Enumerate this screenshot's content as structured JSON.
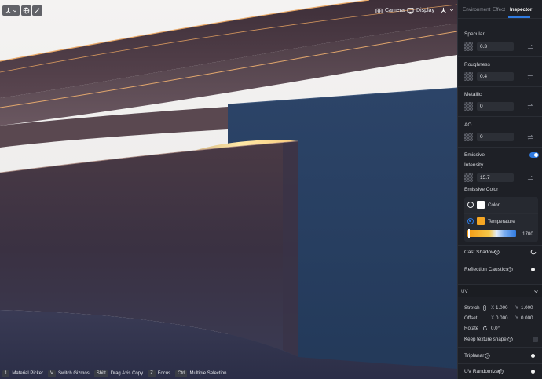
{
  "viewport": {
    "toolbar_left": {
      "transform_icon": "transform-gizmo-icon",
      "globe_icon": "globe-icon",
      "wand_icon": "magic-wand-icon"
    },
    "toolbar_right": {
      "camera_label": "Camera",
      "display_label": "Display",
      "lighting_icon": "lighting-icon"
    },
    "shortcuts": [
      {
        "key": "1",
        "label": "Material Picker"
      },
      {
        "key": "V",
        "label": "Switch Gizmos"
      },
      {
        "key": "Shift",
        "label": "Drag Axis Copy"
      },
      {
        "key": "Z",
        "label": "Focus"
      },
      {
        "key": "Ctrl",
        "label": "Multiple Selection"
      }
    ]
  },
  "inspector": {
    "tabs": [
      {
        "label": "Environment",
        "active": false
      },
      {
        "label": "Effect",
        "active": false
      },
      {
        "label": "Inspector",
        "active": true
      }
    ],
    "specular": {
      "label": "Specular",
      "value": "0.3"
    },
    "roughness": {
      "label": "Roughness",
      "value": "0.4"
    },
    "metallic": {
      "label": "Metallic",
      "value": "0"
    },
    "ao": {
      "label": "AO",
      "value": "0"
    },
    "emissive": {
      "label": "Emissive",
      "enabled": true,
      "intensity_label": "Intensity",
      "intensity_value": "15.7",
      "color_label": "Emissive Color",
      "color_option": "Color",
      "color_swatch": "#ffffff",
      "temperature_option": "Temperature",
      "temperature_swatch": "#f5a623",
      "temperature_value": "1700"
    },
    "cast_shadow": {
      "label": "Cast Shadow"
    },
    "reflection_caustics": {
      "label": "Reflection Caustics"
    },
    "uv": {
      "label": "UV",
      "stretch_label": "Stretch",
      "stretch_x_label": "X",
      "stretch_x": "1.000",
      "stretch_y_label": "Y",
      "stretch_y": "1.000",
      "offset_label": "Offset",
      "offset_x_label": "X",
      "offset_x": "0.000",
      "offset_y_label": "Y",
      "offset_y": "0.000",
      "rotate_label": "Rotate",
      "rotate_value": "0.0°",
      "keep_shape_label": "Keep texture shape"
    },
    "triplanar": {
      "label": "Triplanar"
    },
    "uv_randomizer": {
      "label": "UV Randomizer"
    }
  },
  "colors": {
    "accent": "#2f7ae0",
    "panel_bg": "#1e2026",
    "field_bg": "#2c2f36"
  }
}
